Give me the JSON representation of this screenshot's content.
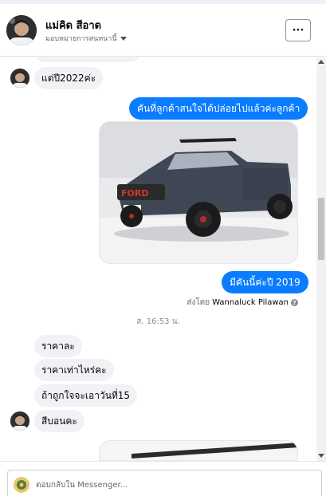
{
  "header": {
    "name": "แม่คิด สีอาด",
    "subtitle": "มอบหมายการสนทนานี้",
    "more_label": "···"
  },
  "messages": [
    {
      "direction": "in",
      "text": "แต่ปี2022ค่ะ"
    },
    {
      "direction": "out",
      "text": "คันที่ลูกค้าสนใจได้ปล่อยไปแล้วค่ะลูกค้า"
    },
    {
      "direction": "out",
      "type": "photo",
      "description": "grey-pickup-truck"
    },
    {
      "direction": "out",
      "text": "มีคันนี้ค่ะปี 2019"
    },
    {
      "direction": "in",
      "text": "ราคาละ"
    },
    {
      "direction": "in",
      "text": "ราคาเท่าไหร่คะ"
    },
    {
      "direction": "in",
      "text": "ถ้าถูกใจจะเอาวันที่15"
    },
    {
      "direction": "in",
      "text": "สีบอนคะ"
    }
  ],
  "sent_by": {
    "prefix": "ส่งโดย",
    "name": "Wannaluck Pilawan",
    "help": "?"
  },
  "timestamp": "ส. 16:53 น.",
  "composer": {
    "placeholder": "ตอบกลับใน Messenger..."
  },
  "colors": {
    "outgoing_bubble": "#0a7cff",
    "incoming_bubble": "#f0f2f5",
    "secondary_text": "#65676b"
  }
}
